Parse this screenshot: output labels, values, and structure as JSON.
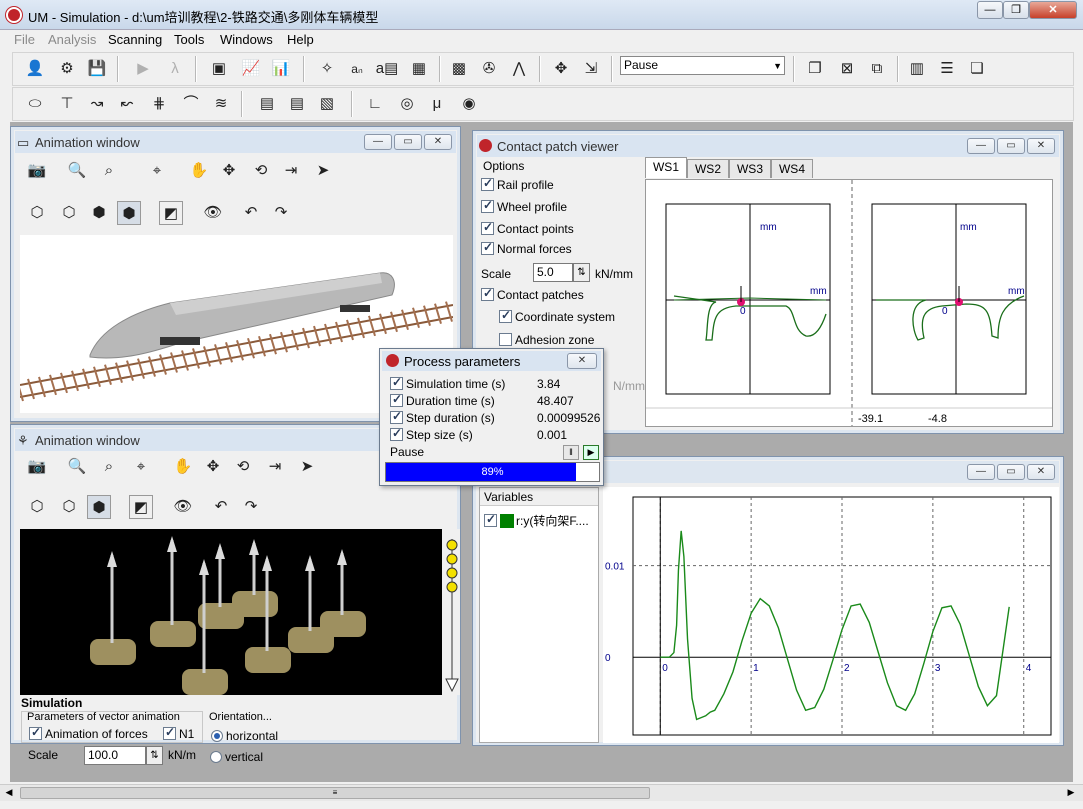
{
  "window": {
    "title": "UM - Simulation - d:\\um培训教程\\2-铁路交通\\多刚体车辆模型"
  },
  "menu": {
    "file": "File",
    "analysis": "Analysis",
    "scanning": "Scanning",
    "tools": "Tools",
    "windows": "Windows",
    "help": "Help"
  },
  "toolbar": {
    "mode_select_value": "Pause"
  },
  "animation_window_top": {
    "title": "Animation window"
  },
  "contact_patch_viewer": {
    "title": "Contact patch viewer",
    "options_header": "Options",
    "rail_profile": "Rail profile",
    "wheel_profile": "Wheel profile",
    "contact_points": "Contact points",
    "normal_forces": "Normal forces",
    "scale_label": "Scale",
    "scale_value": "5.0",
    "scale_unit": "kN/mm",
    "contact_patches": "Contact patches",
    "coordinate_system": "Coordinate system",
    "adhesion_zone": "Adhesion zone",
    "hidden_unit": "N/mm",
    "tabs": [
      "WS1",
      "WS2",
      "WS3",
      "WS4"
    ],
    "axis_unit_y": "mm",
    "axis_unit_x": "mm",
    "origin_label": "0",
    "readout_left": "-39.1",
    "readout_right": "-4.8"
  },
  "process_parameters": {
    "title": "Process parameters",
    "rows": [
      {
        "label": "Simulation time (s)",
        "value": "3.84"
      },
      {
        "label": "Duration time (s)",
        "value": "48.407"
      },
      {
        "label": "Step duration (s)",
        "value": "0.00099526"
      },
      {
        "label": "Step size (s)",
        "value": "0.001"
      }
    ],
    "status": "Pause",
    "progress_label": "89%",
    "progress": 0.89
  },
  "animation_window_bottom": {
    "title": "Animation window",
    "section_title": "Simulation",
    "params_group": "Parameters of vector animation",
    "animation_of_forces": "Animation of forces",
    "n1": "N1",
    "scale_label": "Scale",
    "scale_value": "100.0",
    "scale_unit": "kN/m",
    "orientation_group": "Orientation...",
    "horizontal": "horizontal",
    "vertical": "vertical"
  },
  "graph_window": {
    "variables_header": "Variables",
    "variable_name": "r:y(转向架F....",
    "variable_color": "#008000"
  },
  "chart_data": {
    "type": "line",
    "title": "",
    "xlabel": "",
    "ylabel": "",
    "x_ticks": [
      "0",
      "1",
      "2",
      "3",
      "4"
    ],
    "y_ticks": [
      "0",
      "0.01"
    ],
    "xlim": [
      -0.3,
      4.3
    ],
    "ylim": [
      -0.0085,
      0.0175
    ],
    "grid": true,
    "series": [
      {
        "color": "#1a8a1a",
        "x": [
          0,
          0.05,
          0.1,
          0.15,
          0.18,
          0.2,
          0.23,
          0.26,
          0.3,
          0.35,
          0.4,
          0.45,
          0.5,
          0.55,
          0.6,
          0.7,
          0.8,
          0.9,
          1.0,
          1.1,
          1.2,
          1.3,
          1.4,
          1.5,
          1.6,
          1.7,
          1.8,
          1.9,
          2.0,
          2.1,
          2.2,
          2.3,
          2.4,
          2.5,
          2.6,
          2.7,
          2.8,
          2.9,
          3.0,
          3.1,
          3.2,
          3.3,
          3.4,
          3.5,
          3.6,
          3.7,
          3.84
        ],
        "y": [
          0,
          0,
          0,
          0.0005,
          0.0035,
          0.0095,
          0.0138,
          0.011,
          0.002,
          -0.0045,
          -0.0068,
          -0.0066,
          -0.0064,
          -0.006,
          -0.0058,
          -0.004,
          -0.0016,
          0.0018,
          0.0048,
          0.0064,
          0.0056,
          0.0032,
          -0.0002,
          -0.0036,
          -0.0058,
          -0.0055,
          -0.0035,
          -0.0003,
          0.003,
          0.0056,
          0.0058,
          0.0038,
          0.0005,
          -0.0028,
          -0.0053,
          -0.0058,
          -0.004,
          -0.0007,
          0.0028,
          0.0054,
          0.0056,
          0.0036,
          0.0002,
          -0.0032,
          -0.0053,
          -0.0042,
          0.0055
        ]
      }
    ]
  }
}
